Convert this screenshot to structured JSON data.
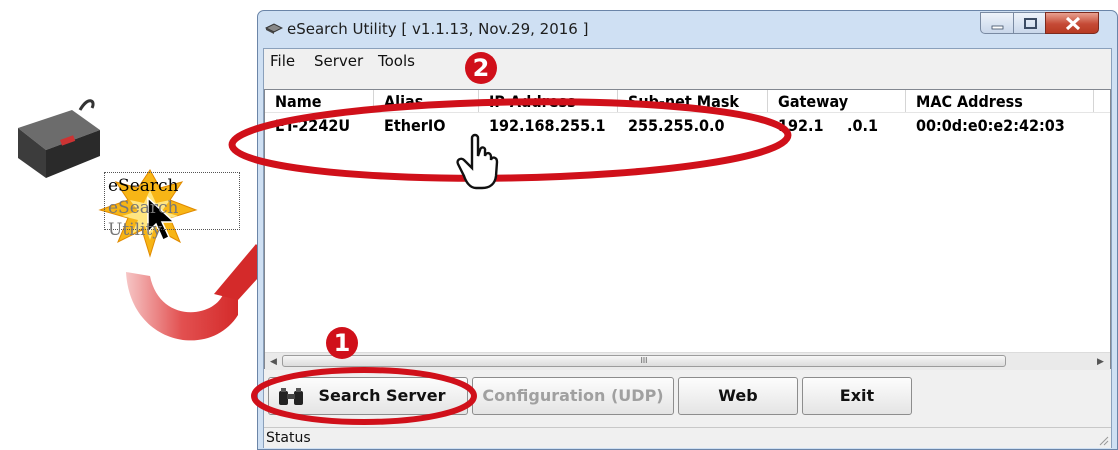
{
  "desktop_icon": {
    "name": "eSearch",
    "caption": "eSearch Utility"
  },
  "window": {
    "title": "eSearch Utility [ v1.1.13, Nov.29, 2016 ]"
  },
  "menu": [
    "File",
    "Server",
    "Tools"
  ],
  "table": {
    "columns": [
      "Name",
      "Alias",
      "IP Address",
      "Sub-net Mask",
      "Gateway",
      "MAC Address"
    ],
    "rows": [
      [
        "ET-2242U",
        "EtherIO",
        "192.168.255.1",
        "255.255.0.0",
        "192.1",
        ".0.1",
        "00:0d:e0:e2:42:03"
      ]
    ]
  },
  "scrollbar": {
    "grip": "III"
  },
  "buttons": {
    "search": "Search Server",
    "config": "Configuration (UDP)",
    "web": "Web",
    "exit": "Exit"
  },
  "status": "Status",
  "annotations": {
    "step1": "1",
    "step2": "2"
  },
  "colors": {
    "accent_red": "#d0101a",
    "title_blue": "#cfe0f3"
  }
}
